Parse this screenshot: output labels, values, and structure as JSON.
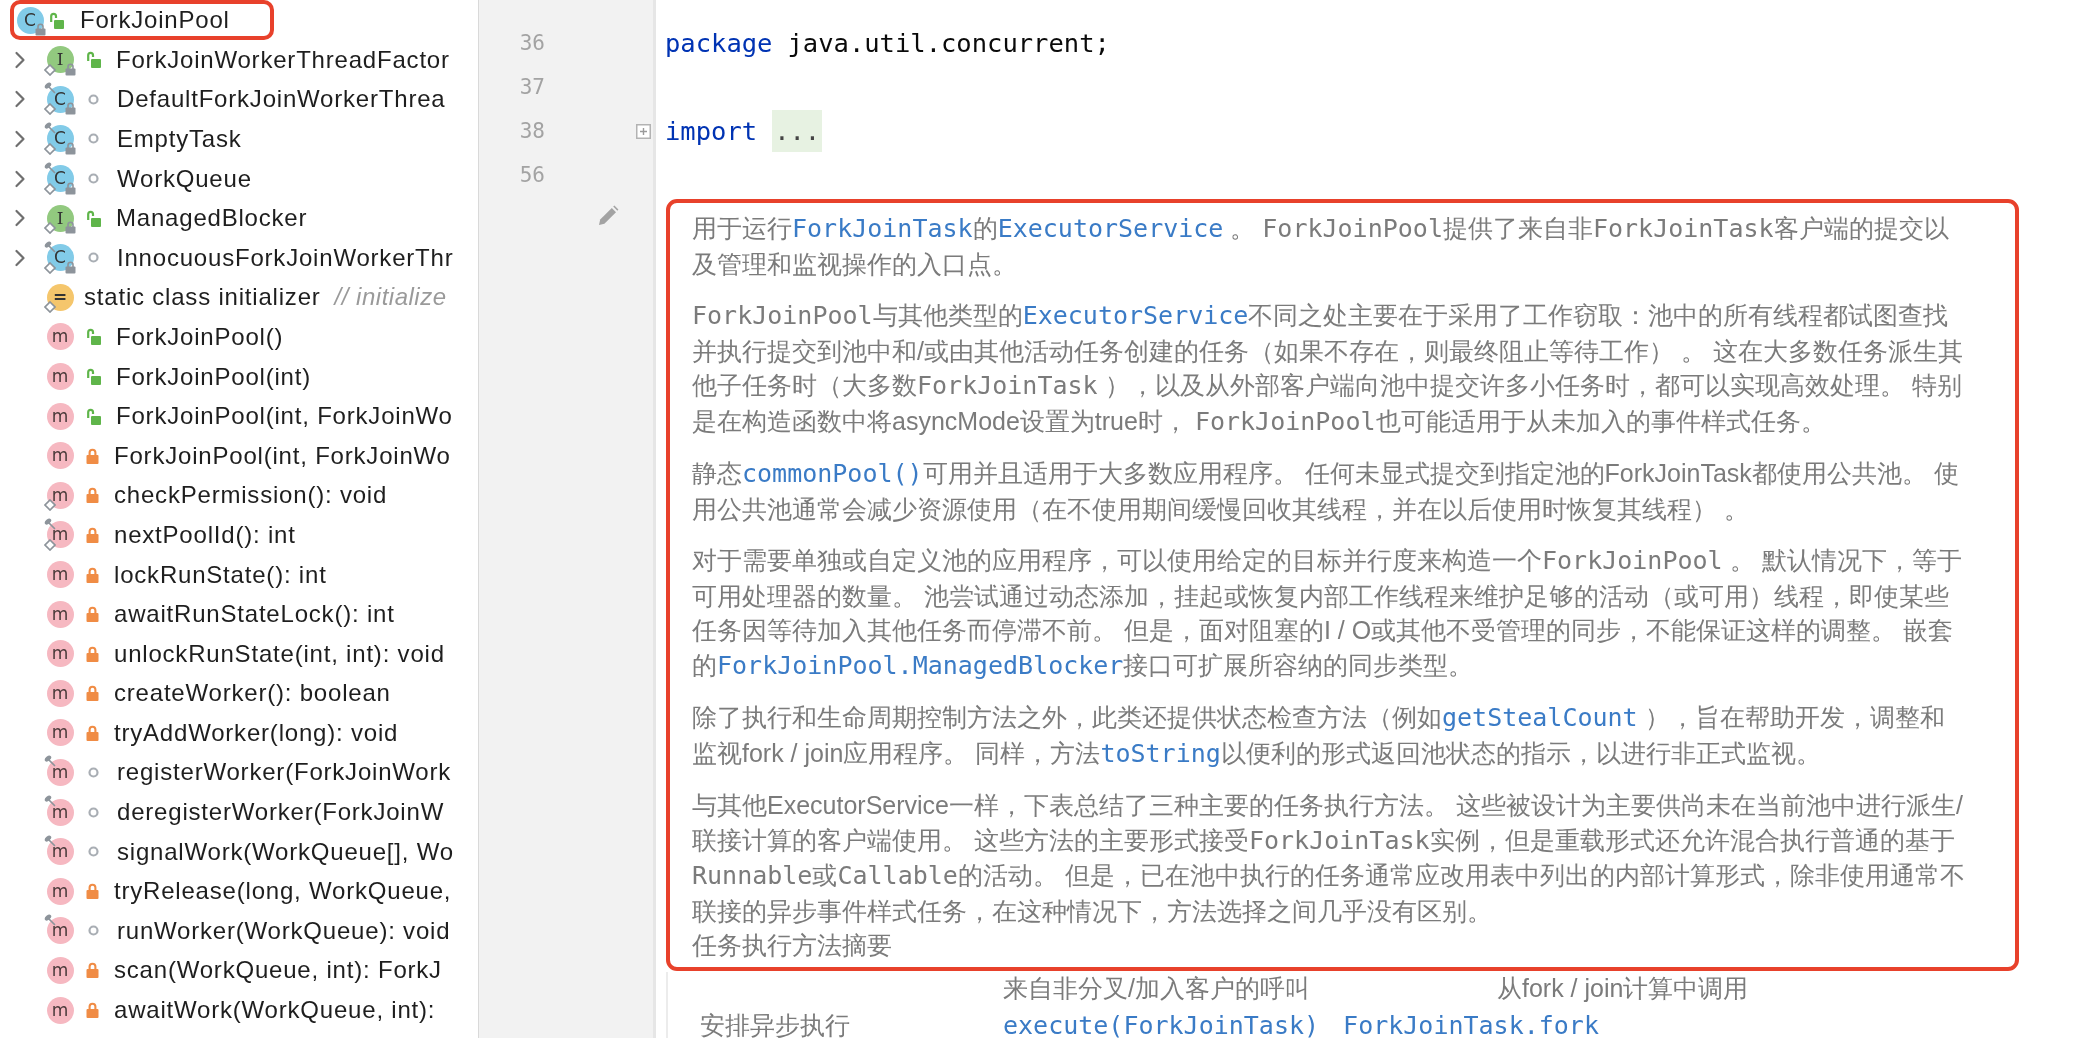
{
  "structure": {
    "tree": [
      {
        "label": "ForkJoinPool",
        "kind": "class",
        "icon_letter": "C",
        "access": {
          "kind": "public"
        },
        "static": false,
        "final": false,
        "readonly": true,
        "highlighted": true,
        "children": [
          {
            "label": "ForkJoinWorkerThreadFactor",
            "kind": "interface",
            "icon_letter": "I",
            "access": {
              "kind": "public"
            },
            "static": true,
            "final": false,
            "readonly": true,
            "expanded": false
          },
          {
            "label": "DefaultForkJoinWorkerThrea",
            "kind": "class",
            "icon_letter": "C",
            "access": {
              "kind": "package"
            },
            "static": true,
            "final": true,
            "readonly": true,
            "expanded": false
          },
          {
            "label": "EmptyTask",
            "kind": "class",
            "icon_letter": "C",
            "access": {
              "kind": "package"
            },
            "static": true,
            "final": true,
            "readonly": true,
            "expanded": false
          },
          {
            "label": "WorkQueue",
            "kind": "class",
            "icon_letter": "C",
            "access": {
              "kind": "package"
            },
            "static": true,
            "final": true,
            "readonly": true,
            "expanded": false
          },
          {
            "label": "ManagedBlocker",
            "kind": "interface",
            "icon_letter": "I",
            "access": {
              "kind": "public"
            },
            "static": true,
            "final": false,
            "readonly": true,
            "expanded": false
          },
          {
            "label": "InnocuousForkJoinWorkerThr",
            "kind": "class",
            "icon_letter": "C",
            "access": {
              "kind": "package"
            },
            "static": true,
            "final": true,
            "readonly": true,
            "expanded": false
          },
          {
            "label": "static class initializer",
            "kind": "initializer",
            "icon_letter": "=",
            "comment": "// initialize",
            "static": true,
            "final": false,
            "readonly": false
          },
          {
            "label": "ForkJoinPool()",
            "kind": "method",
            "icon_letter": "m",
            "access": {
              "kind": "public"
            },
            "static": false,
            "final": false,
            "readonly": false
          },
          {
            "label": "ForkJoinPool(int)",
            "kind": "method",
            "icon_letter": "m",
            "access": {
              "kind": "public"
            },
            "static": false,
            "final": false,
            "readonly": false
          },
          {
            "label": "ForkJoinPool(int, ForkJoinWo",
            "kind": "method",
            "icon_letter": "m",
            "access": {
              "kind": "public"
            },
            "static": false,
            "final": false,
            "readonly": false
          },
          {
            "label": "ForkJoinPool(int, ForkJoinWo",
            "kind": "method",
            "icon_letter": "m",
            "access": {
              "kind": "private"
            },
            "static": false,
            "final": false,
            "readonly": false
          },
          {
            "label": "checkPermission(): void",
            "kind": "method",
            "icon_letter": "m",
            "access": {
              "kind": "private"
            },
            "static": true,
            "final": false,
            "readonly": false
          },
          {
            "label": "nextPoolId(): int",
            "kind": "method",
            "icon_letter": "m",
            "access": {
              "kind": "private"
            },
            "static": true,
            "final": true,
            "readonly": false
          },
          {
            "label": "lockRunState(): int",
            "kind": "method",
            "icon_letter": "m",
            "access": {
              "kind": "private"
            },
            "static": false,
            "final": false,
            "readonly": false
          },
          {
            "label": "awaitRunStateLock(): int",
            "kind": "method",
            "icon_letter": "m",
            "access": {
              "kind": "private"
            },
            "static": false,
            "final": false,
            "readonly": false
          },
          {
            "label": "unlockRunState(int, int): void",
            "kind": "method",
            "icon_letter": "m",
            "access": {
              "kind": "private"
            },
            "static": false,
            "final": false,
            "readonly": false
          },
          {
            "label": "createWorker(): boolean",
            "kind": "method",
            "icon_letter": "m",
            "access": {
              "kind": "private"
            },
            "static": false,
            "final": false,
            "readonly": false
          },
          {
            "label": "tryAddWorker(long): void",
            "kind": "method",
            "icon_letter": "m",
            "access": {
              "kind": "private"
            },
            "static": false,
            "final": false,
            "readonly": false
          },
          {
            "label": "registerWorker(ForkJoinWork",
            "kind": "method",
            "icon_letter": "m",
            "access": {
              "kind": "package"
            },
            "static": false,
            "final": true,
            "readonly": false
          },
          {
            "label": "deregisterWorker(ForkJoinW",
            "kind": "method",
            "icon_letter": "m",
            "access": {
              "kind": "package"
            },
            "static": false,
            "final": true,
            "readonly": false
          },
          {
            "label": "signalWork(WorkQueue[], Wo",
            "kind": "method",
            "icon_letter": "m",
            "access": {
              "kind": "package"
            },
            "static": false,
            "final": true,
            "readonly": false
          },
          {
            "label": "tryRelease(long, WorkQueue,",
            "kind": "method",
            "icon_letter": "m",
            "access": {
              "kind": "private"
            },
            "static": false,
            "final": false,
            "readonly": false
          },
          {
            "label": "runWorker(WorkQueue): void",
            "kind": "method",
            "icon_letter": "m",
            "access": {
              "kind": "package"
            },
            "static": false,
            "final": true,
            "readonly": false
          },
          {
            "label": "scan(WorkQueue, int): ForkJ",
            "kind": "method",
            "icon_letter": "m",
            "access": {
              "kind": "private"
            },
            "static": false,
            "final": false,
            "readonly": false
          },
          {
            "label": "awaitWork(WorkQueue, int):",
            "kind": "method",
            "icon_letter": "m",
            "access": {
              "kind": "private"
            },
            "static": false,
            "final": false,
            "readonly": false
          }
        ]
      }
    ]
  },
  "editor": {
    "lines": [
      {
        "number": "36",
        "tokens": [
          {
            "kind": "keyword",
            "text": "package"
          },
          {
            "kind": "plain",
            "text": "java.util.concurrent;"
          }
        ]
      },
      {
        "number": "37"
      },
      {
        "number": "38",
        "collapsed": true,
        "tokens": [
          {
            "kind": "keyword",
            "text": "import"
          },
          {
            "kind": "fold",
            "text": "..."
          }
        ]
      },
      {
        "number": "56"
      }
    ],
    "doc": {
      "highlighted": true,
      "paragraphs": [
        {
          "segments": [
            {
              "kind": "text",
              "text": "用于运行"
            },
            {
              "kind": "link",
              "text": "ForkJoinTask"
            },
            {
              "kind": "text",
              "text": "的"
            },
            {
              "kind": "link",
              "text": "ExecutorService"
            },
            {
              "kind": "text",
              "text": " 。 "
            },
            {
              "kind": "code",
              "text": "ForkJoinPool"
            },
            {
              "kind": "text",
              "text": "提供了来自非"
            },
            {
              "kind": "code",
              "text": "ForkJoinTask"
            },
            {
              "kind": "text",
              "text": "客户端的提交以及管理和监视操作的入口点。"
            }
          ]
        },
        {
          "segments": [
            {
              "kind": "code",
              "text": "ForkJoinPool"
            },
            {
              "kind": "text",
              "text": "与其他类型的"
            },
            {
              "kind": "link",
              "text": "ExecutorService"
            },
            {
              "kind": "text",
              "text": "不同之处主要在于采用了工作窃取：池中的所有线程都试图查找并执行提交到池中和/或由其他活动任务创建的任务（如果不存在，则最终阻止等待工作） 。 这在大多数任务派生其他子任务时（大多数"
            },
            {
              "kind": "code",
              "text": "ForkJoinTask"
            },
            {
              "kind": "text",
              "text": " ），以及从外部客户端向池中提交许多小任务时，都可以实现高效处理。 特别是在构造函数中将asyncMode设置为true时， "
            },
            {
              "kind": "code",
              "text": "ForkJoinPool"
            },
            {
              "kind": "text",
              "text": "也可能适用于从未加入的事件样式任务。"
            }
          ]
        },
        {
          "segments": [
            {
              "kind": "text",
              "text": "静态"
            },
            {
              "kind": "link",
              "text": "commonPool()"
            },
            {
              "kind": "text",
              "text": "可用并且适用于大多数应用程序。 任何未显式提交到指定池的ForkJoinTask都使用公共池。 使用公共池通常会减少资源使用（在不使用期间缓慢回收其线程，并在以后使用时恢复其线程） 。"
            }
          ]
        },
        {
          "segments": [
            {
              "kind": "text",
              "text": "对于需要单独或自定义池的应用程序，可以使用给定的目标并行度来构造一个"
            },
            {
              "kind": "code",
              "text": "ForkJoinPool"
            },
            {
              "kind": "text",
              "text": " 。 默认情况下，等于可用处理器的数量。 池尝试通过动态添加，挂起或恢复内部工作线程来维护足够的活动（或可用）线程，即使某些任务因等待加入其他任务而停滞不前。 但是，面对阻塞的I / O或其他不受管理的同步，不能保证这样的调整。 嵌套的"
            },
            {
              "kind": "link",
              "text": "ForkJoinPool.ManagedBlocker"
            },
            {
              "kind": "text",
              "text": "接口可扩展所容纳的同步类型。"
            }
          ]
        },
        {
          "segments": [
            {
              "kind": "text",
              "text": "除了执行和生命周期控制方法之外，此类还提供状态检查方法（例如"
            },
            {
              "kind": "link",
              "text": "getStealCount"
            },
            {
              "kind": "text",
              "text": " ），旨在帮助开发，调整和监视fork / join应用程序。 同样，方法"
            },
            {
              "kind": "link",
              "text": "toString"
            },
            {
              "kind": "text",
              "text": "以便利的形式返回池状态的指示，以进行非正式监视。"
            }
          ]
        },
        {
          "segments": [
            {
              "kind": "text",
              "text": "与其他ExecutorService一样，下表总结了三种主要的任务执行方法。 这些被设计为主要供尚未在当前池中进行派生/联接计算的客户端使用。 这些方法的主要形式接受"
            },
            {
              "kind": "code",
              "text": "ForkJoinTask"
            },
            {
              "kind": "text",
              "text": "实例，但是重载形式还允许混合执行普通的基于"
            },
            {
              "kind": "code",
              "text": "Runnable"
            },
            {
              "kind": "text",
              "text": "或"
            },
            {
              "kind": "code",
              "text": "Callable"
            },
            {
              "kind": "text",
              "text": "的活动。 但是，已在池中执行的任务通常应改用表中列出的内部计算形式，除非使用通常不联接的异步事件样式任务，在这种情况下，方法选择之间几乎没有区别。"
            }
          ]
        }
      ],
      "caption": "任务执行方法摘要",
      "table": {
        "headers": [
          "来自非分叉/加入客户的呼叫",
          "从fork / join计算中调用"
        ],
        "rows": [
          {
            "label": "安排异步执行",
            "links": [
              "execute(ForkJoinTask)",
              "ForkJoinTask.fork"
            ]
          }
        ]
      }
    }
  }
}
